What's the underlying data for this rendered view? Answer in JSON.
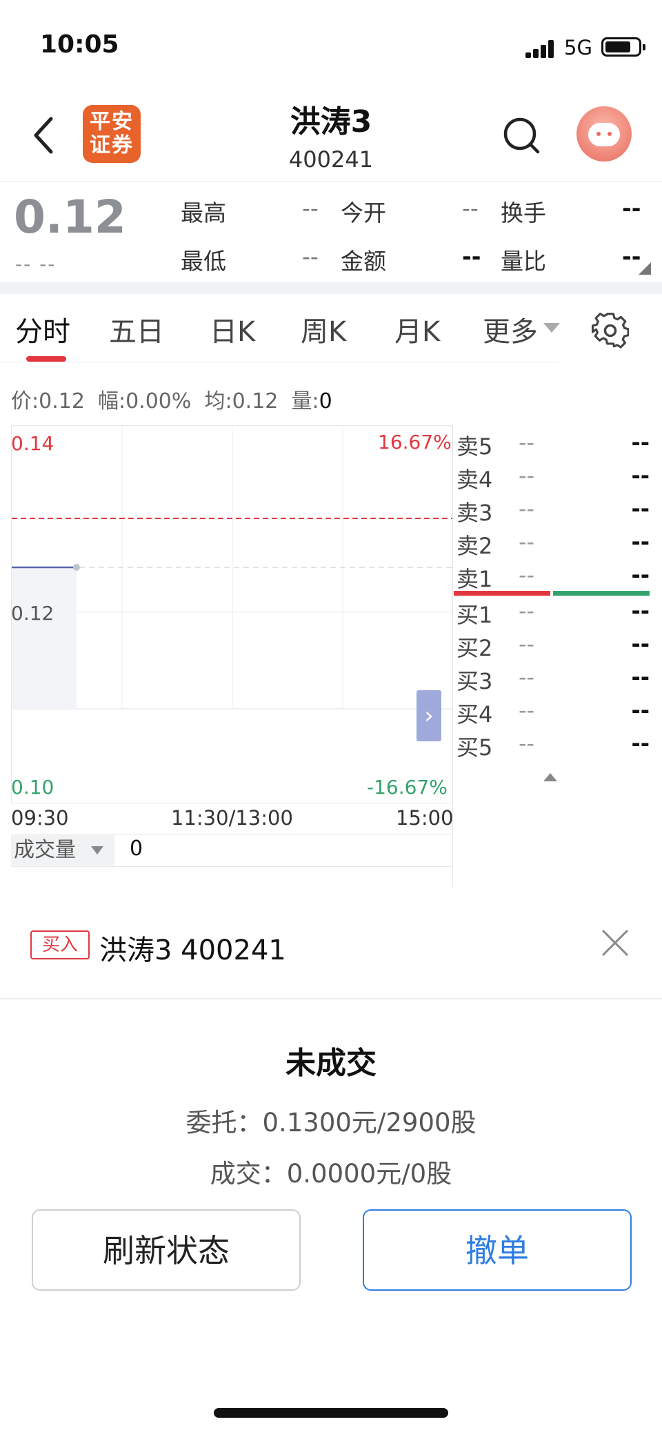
{
  "status_bar": {
    "time": "10:05",
    "network": "5G"
  },
  "header": {
    "logo_text_line1": "平安",
    "logo_text_line2": "证券",
    "stock_name": "洪涛3",
    "stock_code": "400241"
  },
  "quote": {
    "price": "0.12",
    "change": "-- --",
    "fields": [
      {
        "label": "最高",
        "value": "--"
      },
      {
        "label": "今开",
        "value": "--"
      },
      {
        "label": "换手",
        "value": "--"
      },
      {
        "label": "最低",
        "value": "--"
      },
      {
        "label": "金额",
        "value": "--"
      },
      {
        "label": "量比",
        "value": "--"
      }
    ]
  },
  "tabs": [
    "分时",
    "五日",
    "日K",
    "周K",
    "月K",
    "更多"
  ],
  "info_bar": {
    "price_label": "价:",
    "price": "0.12",
    "amp_label": "幅:",
    "amp": "0.00%",
    "avg_label": "均:",
    "avg": "0.12",
    "vol_label": "量:",
    "vol": "0"
  },
  "chart_data": {
    "type": "line",
    "title": "",
    "x_ticks": [
      "09:30",
      "11:30/13:00",
      "15:00"
    ],
    "y_left_ticks": [
      "0.14",
      "0.12",
      "0.10"
    ],
    "y_right_ticks": [
      "16.67%",
      "-16.67%"
    ],
    "ylim": [
      0.1,
      0.14
    ],
    "series": [
      {
        "values": [
          0.12,
          0.12
        ]
      }
    ],
    "x": [
      "09:30",
      "09:48"
    ],
    "reference_price": 0.12,
    "grid": true
  },
  "order_book": {
    "sell": [
      {
        "label": "卖5",
        "price": "--",
        "volume": "--"
      },
      {
        "label": "卖4",
        "price": "--",
        "volume": "--"
      },
      {
        "label": "卖3",
        "price": "--",
        "volume": "--"
      },
      {
        "label": "卖2",
        "price": "--",
        "volume": "--"
      },
      {
        "label": "卖1",
        "price": "--",
        "volume": "--"
      }
    ],
    "buy": [
      {
        "label": "买1",
        "price": "--",
        "volume": "--"
      },
      {
        "label": "买2",
        "price": "--",
        "volume": "--"
      },
      {
        "label": "买3",
        "price": "--",
        "volume": "--"
      },
      {
        "label": "买4",
        "price": "--",
        "volume": "--"
      },
      {
        "label": "买5",
        "price": "--",
        "volume": "--"
      }
    ]
  },
  "volume_panel": {
    "label": "成交量",
    "value": "0"
  },
  "order_sheet": {
    "tag": "买入",
    "title": "洪涛3 400241",
    "status": "未成交",
    "entrust_label": "委托：",
    "entrust_value": "0.1300元/2900股",
    "deal_label": "成交：",
    "deal_value": "0.0000元/0股",
    "refresh_button": "刷新状态",
    "cancel_button": "撤单"
  },
  "colors": {
    "up": "#e2373f",
    "down": "#34a36b",
    "accent": "#2f7de1",
    "brand": "#e8622c"
  }
}
